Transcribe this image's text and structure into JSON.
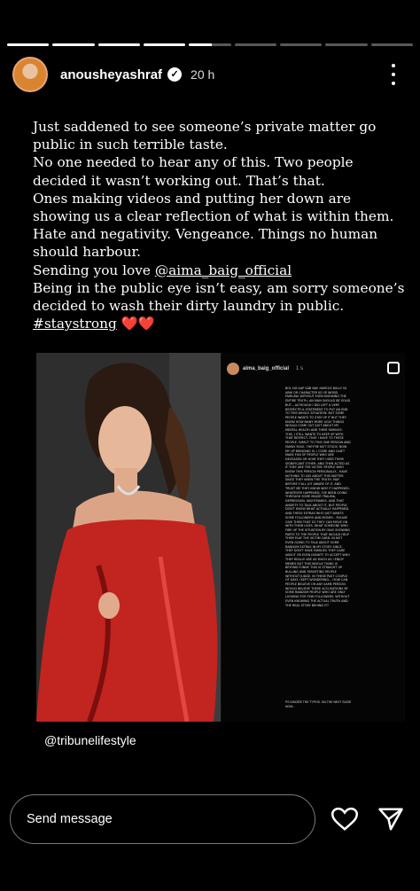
{
  "story_progress": [
    1,
    1,
    1,
    1,
    0.55,
    0,
    0,
    0,
    0
  ],
  "header": {
    "username": "anousheyashraf",
    "verified_icon": "verified-badge-icon",
    "time": "20 h",
    "more_icon": "more-vertical-icon"
  },
  "caption": {
    "line1": "Just saddened to see someone’s private matter go public in such terrible taste.",
    "line2": "No one needed to hear any of this. Two people decided it wasn’t working out. That’s that.",
    "line3": "Ones making videos and putting her down are showing us a clear reflection of what is within them.",
    "line4": "Hate and negativity. Vengeance. Things no human should harbour.",
    "line5_prefix": "Sending you love ",
    "mention": "@aima_baig_official",
    "line6": "Being in the public eye isn’t easy, am sorry someone’s decided to wash their dirty laundry in public.",
    "hashtag": "#staystrong",
    "hearts": "❤️❤️"
  },
  "shared_story": {
    "username": "aima_baig_official",
    "time": "1 s",
    "text": "Bol lya aap sab nay. Harcus bully ya abhi or character ko ye word fairlaw. Without even knowing the entire truth, an man should be solid but... Although I did left a very respectful statement to put an end to this whole situation. But some people wants to stay up it but they know how many more ugly things would come out just about my mental health and their families. This, I still wants to keep up with that respect. That I have to these people. Infact to this one person and family role. They're not stuck. Now my up bringing is. I come and can't make fun of people who are deceased or how they used their significant other. And then acted as if they are the victim. People who know this person personally... have nothing to say about this matter since they knew the truth. May before y'all jot aware of it. And trust me they know why it happened. Whatever happened, I've been going through some major trauma, depression, nightmares. And that anxiety to talk about it, but people don't know what actually happened. And these extras who just wants some followers and money... please give them that so they can move on with their lives. What someone who fire up the situation by only showing parts to the people that would help them play the victim card. In not even going to talk about some random extras in my story since. They don't have families they care about or even dignity to accept who they really are as much as I enjoy memes but this whole thing is beyond funny. This is straight up bulling and targeting people without judge. In these past couple of days I kept wondering... How can people believe or any same person would believe these accusations by some random people who are only looking for few followers. Without even knowing the actual truth and the real story behind it?",
    "note": "PS ignore the typos. On the next slide now..."
  },
  "credit": "@tribunelifestyle",
  "footer": {
    "send_placeholder": "Send message",
    "like_icon": "heart-icon",
    "share_icon": "send-icon"
  }
}
